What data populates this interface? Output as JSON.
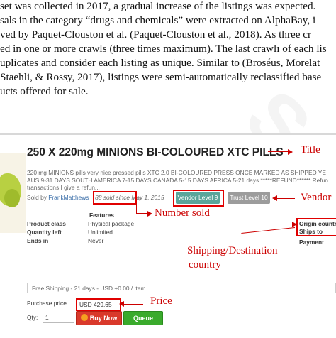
{
  "paper": {
    "lines": [
      "set was collected in 2017, a gradual increase of the listings was expected.",
      "sals in the category “drugs and chemicals” were extracted on AlphaBay, i",
      "ved by Paquet-Clouston et al. (Paquet-Clouston et al., 2018). As three cr",
      "ed in one or more crawls (three times maximum). The last crawlı of each lis",
      "uplicates and consider each listing as unique. Similar to (Broséus, Morelat",
      "Staehli, & Rossy, 2017), listings were semi-automatically reclassified base",
      "ucts offered for sale."
    ]
  },
  "listing": {
    "title": "250 X 220mg MINIONS BI-COLOURED XTC PILLS",
    "description_lines": [
      "220 mg MINIONS pills very nice pressed pills XTC 2.0 BI-COLOURED PRESS ONCE MARKED AS SHIPPED YE",
      "AUS 9-31 DAYS SOUTH AMERICA 7-15 DAYS CANADA 5-15 DAYS AFRICA 5-21 days *****REFUND****** Refun",
      "transactions I give a refun..."
    ],
    "sold_by_prefix": "Sold by",
    "seller": "FrankMatthews",
    "sold_count": "88 sold since",
    "since_date": "May 1, 2015",
    "vendor_level": "Vendor Level 9",
    "trust_level": "Trust Level 10",
    "features_header": "Features",
    "features": [
      {
        "label": "Product class",
        "value": "Physical package"
      },
      {
        "label": "Quantity left",
        "value": "Unlimited"
      },
      {
        "label": "Ends in",
        "value": "Never"
      }
    ],
    "origin_country_label": "Origin countr",
    "ships_to_label": "Ships to",
    "payment_label": "Payment",
    "shipping_option": "Free Shipping - 21 days - USD +0.00 / item",
    "purchase_price_label": "Purchase price",
    "purchase_price": "USD 429.65",
    "qty_label": "Qty:",
    "qty_value": "1",
    "buy_now_label": "Buy Now",
    "queue_label": "Queue"
  },
  "annotations": {
    "title": "Title",
    "vendor": "Vendor",
    "number_sold": "Number sold",
    "shipping_line1": "Shipping/Destination",
    "shipping_line2": "country",
    "price": "Price"
  },
  "colors": {
    "annotation_red": "#cc0000",
    "vendor_badge": "#5aa59a",
    "trust_badge": "#9c9c9c",
    "buy_button": "#d9392b",
    "queue_button": "#3aaa2c"
  }
}
